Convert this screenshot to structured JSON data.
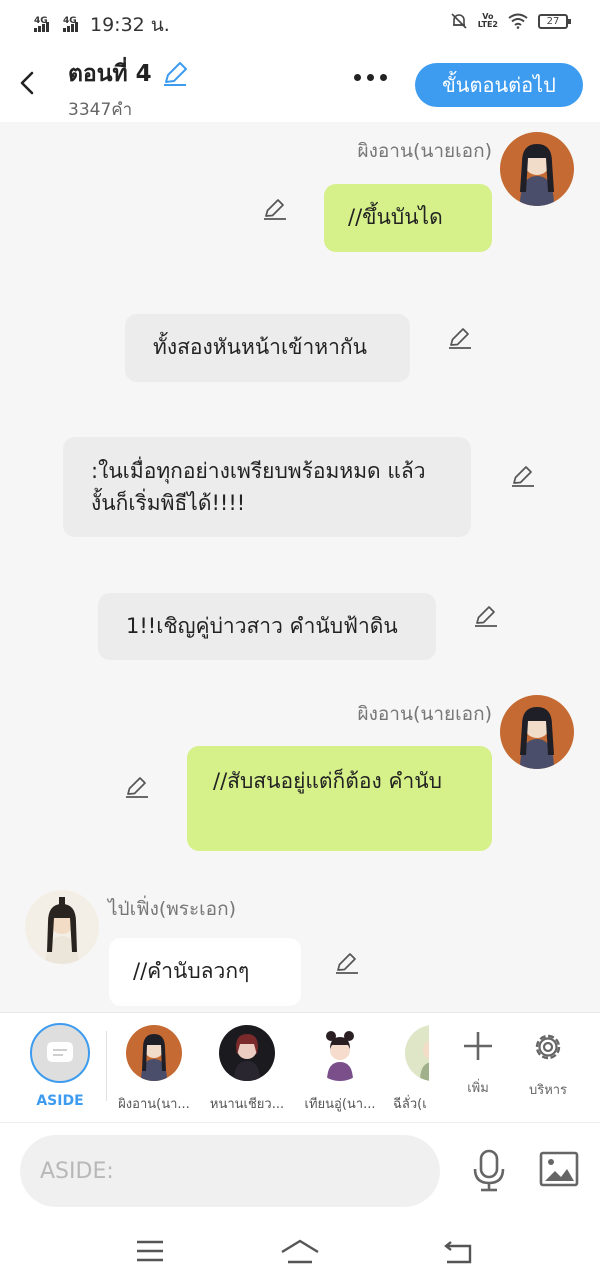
{
  "status_bar": {
    "net1": "4G",
    "net2": "4G",
    "time": "19:32 น.",
    "volte": "Vo\nLTE2",
    "battery": "27"
  },
  "header": {
    "title": "ตอนที่ 4",
    "word_count": "3347คำ",
    "next_button": "ขั้นตอนต่อไป"
  },
  "messages": [
    {
      "speaker": "ผิงอาน(นายเอก)",
      "text": "//ขึ้นบันได"
    },
    {
      "text": "ทั้งสองหันหน้าเข้าหากัน"
    },
    {
      "text": ":ในเมื่อทุกอย่างเพรียบพร้อมหมด แล้ว งั้นก็เริ่มพิธีได้!!!!"
    },
    {
      "text": "1!!เชิญคู่บ่าวสาว คำนับฟ้าดิน"
    },
    {
      "speaker": "ผิงอาน(นายเอก)",
      "text": "//สับสนอยู่แต่ก็ต้อง คำนับ"
    },
    {
      "speaker": "ไป่เฟิ่ง(พระเอก)",
      "text": "//คำนับลวกๆ"
    }
  ],
  "character_bar": {
    "aside_label": "ASIDE",
    "characters": [
      {
        "name": "ผิงอาน(นา..."
      },
      {
        "name": "หนานเชียว..."
      },
      {
        "name": "เทียนอู่(นา..."
      },
      {
        "name": "ฉีลั่ว(เ"
      }
    ],
    "add_label": "เพิ่ม",
    "manage_label": "บริหาร"
  },
  "input_bar": {
    "placeholder": "ASIDE:"
  },
  "colors": {
    "accent": "#3d9cf0",
    "protagonist_bubble": "#d6f08a",
    "narration_bubble": "#ececec",
    "other_bubble": "#ffffff"
  }
}
